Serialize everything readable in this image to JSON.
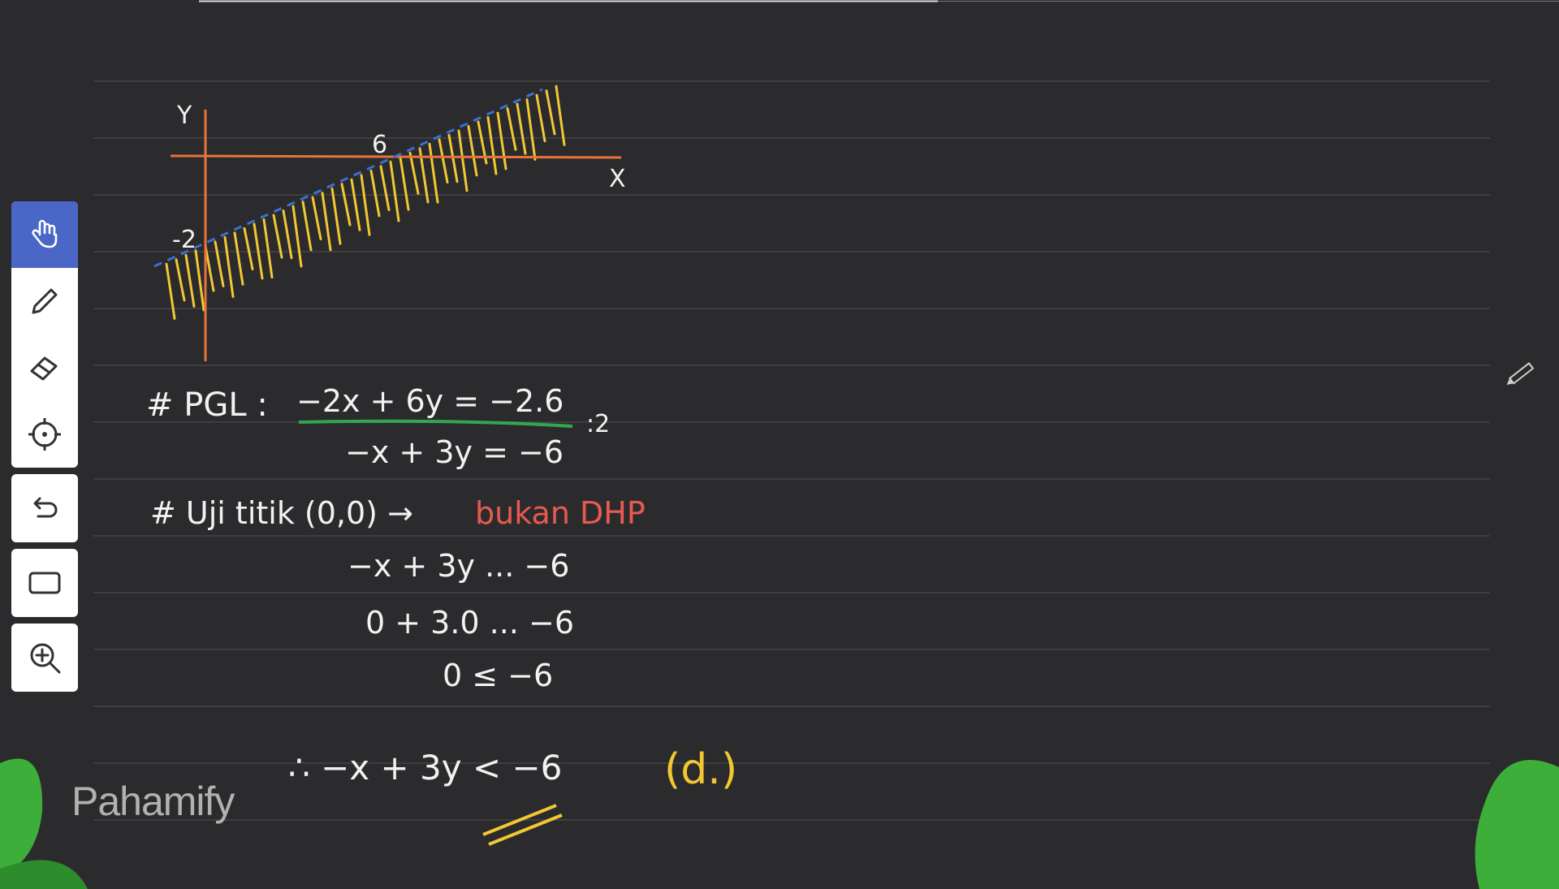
{
  "toolbar": {
    "tools": [
      {
        "icon": "hand-pointer-icon",
        "active": true
      },
      {
        "icon": "pencil-icon",
        "active": false
      },
      {
        "icon": "eraser-icon",
        "active": false
      },
      {
        "icon": "laser-pointer-icon",
        "active": false
      },
      {
        "icon": "undo-icon",
        "active": false
      },
      {
        "icon": "shape-rectangle-icon",
        "active": false
      },
      {
        "icon": "zoom-in-icon",
        "active": false
      }
    ]
  },
  "graph": {
    "y_axis_label": "Y",
    "x_axis_label": "X",
    "x_intercept_label": "6",
    "y_intercept_label": "-2"
  },
  "notes": {
    "line1_prefix": "# PGL :",
    "line1_eq": "−2x + 6y = −2.6",
    "line1_divisor": ":2",
    "line2": "−x + 3y = −6",
    "line3_prefix": "# Uji titik (0,0) →",
    "line3_result": "bukan DHP",
    "line4": "−x + 3y  ...  −6",
    "line5": "0 + 3.0  ...  −6",
    "line6": "0  ≤  −6",
    "conclusion": "∴  −x + 3y < −6",
    "answer": "(d.)"
  },
  "brand": {
    "logo_text": "Pahamify"
  },
  "colors": {
    "background": "#2b2b2d",
    "ruled_line": "#3e3e41",
    "axis": "#e8743a",
    "hatch": "#f2c832",
    "dashed_line": "#3b6fd4",
    "ink_white": "#f2f2f2",
    "ink_red": "#e85a4f",
    "underline_green": "#2fa84f",
    "toolbar_active": "#4a67c7",
    "leaf_green": "#3dae3a"
  }
}
